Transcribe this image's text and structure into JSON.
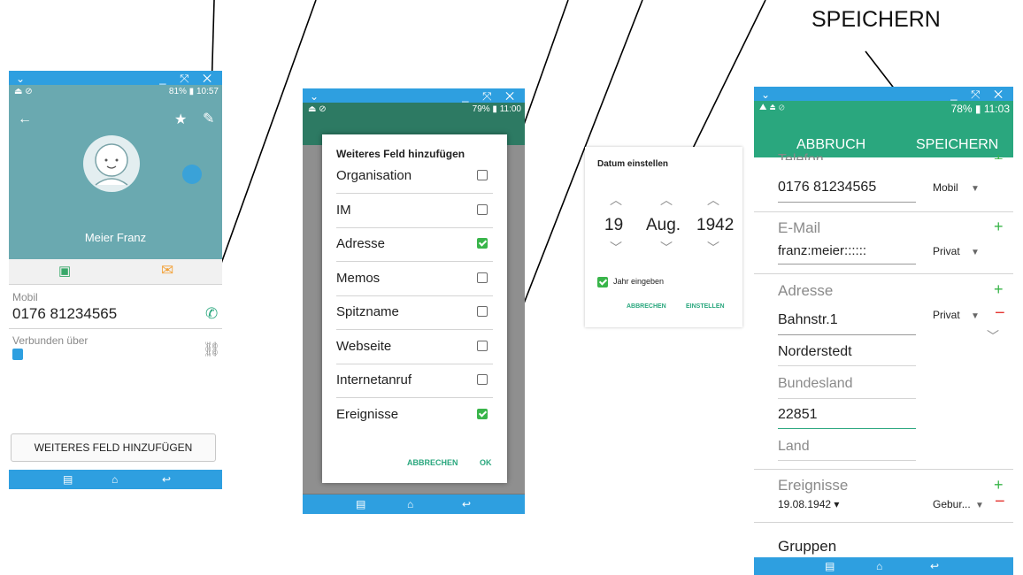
{
  "annotation": {
    "top_label": "SPEICHERN"
  },
  "phone1": {
    "status_right": "81% ▮ 10:57",
    "contact_name": "Meier Franz",
    "phone_label": "Mobil",
    "phone_number": "0176 81234565",
    "linked_label": "Verbunden über",
    "add_field_button": "WEITERES FELD HINZUFÜGEN"
  },
  "phone2": {
    "status_right": "79% ▮ 11:00",
    "dialog_title": "Weiteres Feld hinzufügen",
    "items": [
      {
        "label": "Organisation",
        "checked": false
      },
      {
        "label": "IM",
        "checked": false
      },
      {
        "label": "Adresse",
        "checked": true
      },
      {
        "label": "Memos",
        "checked": false
      },
      {
        "label": "Spitzname",
        "checked": false
      },
      {
        "label": "Webseite",
        "checked": false
      },
      {
        "label": "Internetanruf",
        "checked": false
      },
      {
        "label": "Ereignisse",
        "checked": true
      }
    ],
    "cancel": "ABBRECHEN",
    "ok": "OK"
  },
  "date_dialog": {
    "title": "Datum einstellen",
    "day": "19",
    "month": "Aug.",
    "year": "1942",
    "year_checkbox_label": "Jahr eingeben",
    "cancel": "ABBRECHEN",
    "set": "EINSTELLEN"
  },
  "phone3": {
    "status_right": "78% ▮ 11:03",
    "cancel": "ABBRUCH",
    "save": "SPEICHERN",
    "partial_top": "Telefon",
    "phone_number": "0176 81234565",
    "phone_type": "Mobil",
    "email_header": "E-Mail",
    "email_value": "franz:meier::::::",
    "email_type": "Privat",
    "address_header": "Adresse",
    "street": "Bahnstr.1",
    "address_type": "Privat",
    "city": "Norderstedt",
    "state_placeholder": "Bundesland",
    "zip": "22851",
    "country_placeholder": "Land",
    "events_header": "Ereignisse",
    "event_date": "19.08.1942 ▾",
    "event_type": "Gebur...",
    "groups_header": "Gruppen"
  },
  "colors": {
    "teal": "#6aa9b0",
    "blue": "#2e9fe0",
    "green": "#2aa77e",
    "check": "#39b54a"
  }
}
